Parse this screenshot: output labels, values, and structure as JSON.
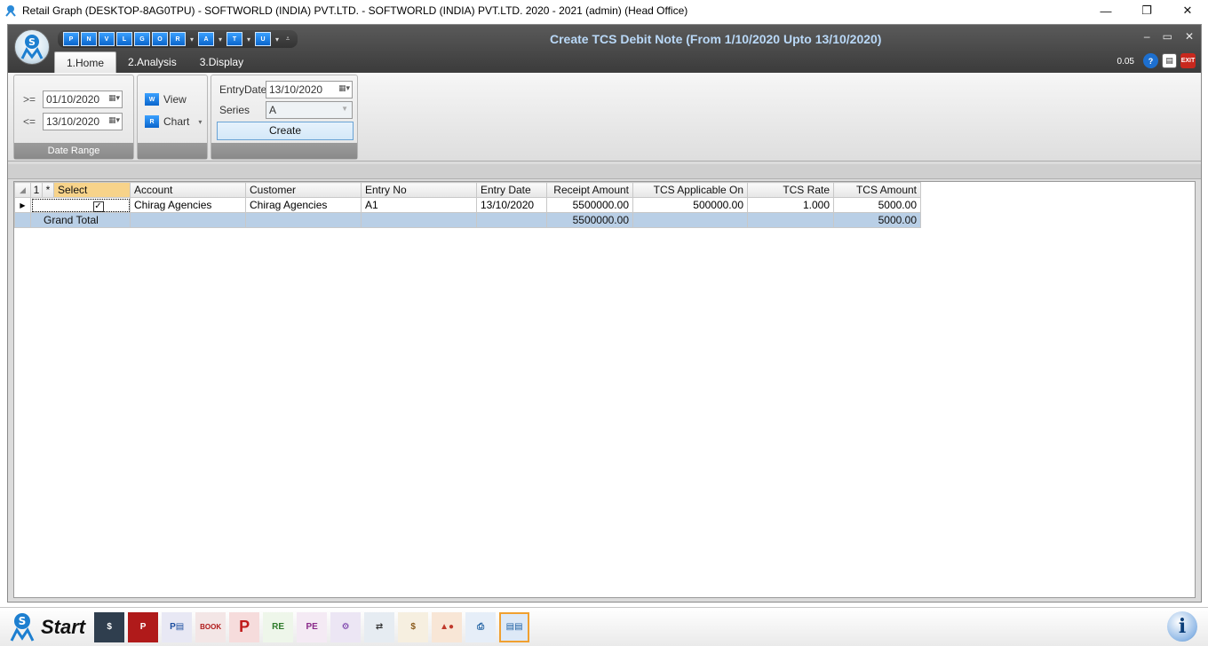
{
  "window": {
    "title": "Retail Graph (DESKTOP-8AG0TPU) - SOFTWORLD (INDIA) PVT.LTD. - SOFTWORLD (INDIA) PVT.LTD.  2020 - 2021 (admin) (Head Office)",
    "minimize": "—",
    "maximize": "❐",
    "close": "✕"
  },
  "app": {
    "title": "Create TCS Debit Note (From 1/10/2020 Upto 13/10/2020)",
    "version": "0.05",
    "qat": [
      "P",
      "N",
      "V",
      "L",
      "G",
      "O",
      "R",
      "A",
      "T",
      "U"
    ],
    "controls": {
      "minimize": "–",
      "restore": "▭",
      "close": "✕"
    }
  },
  "tabs": [
    "1.Home",
    "2.Analysis",
    "3.Display"
  ],
  "date_range": {
    "ge_label": ">=",
    "from": "01/10/2020",
    "le_label": "<=",
    "to": "13/10/2020",
    "group_label": "Date Range"
  },
  "actions": {
    "view": "View",
    "chart": "Chart"
  },
  "create_group": {
    "entry_date_label": "EntryDate",
    "entry_date": "13/10/2020",
    "series_label": "Series",
    "series": "A",
    "create": "Create"
  },
  "grid": {
    "corner": "◢",
    "row_marker": "▶",
    "col_num": "1",
    "col_star": "*",
    "headers": [
      "Select",
      "Account",
      "Customer",
      "Entry No",
      "Entry Date",
      "Receipt Amount",
      "TCS Applicable On",
      "TCS Rate",
      "TCS Amount"
    ],
    "rows": [
      {
        "select": "✓",
        "account": "Chirag Agencies",
        "customer": "Chirag Agencies",
        "entry_no": "A1",
        "entry_date": "13/10/2020",
        "receipt_amount": "5500000.00",
        "tcs_applicable_on": "500000.00",
        "tcs_rate": "1.000",
        "tcs_amount": "5000.00"
      }
    ],
    "total": {
      "label": "Grand Total",
      "receipt_amount": "5500000.00",
      "tcs_amount": "5000.00"
    }
  },
  "taskbar": {
    "start": "Start"
  }
}
